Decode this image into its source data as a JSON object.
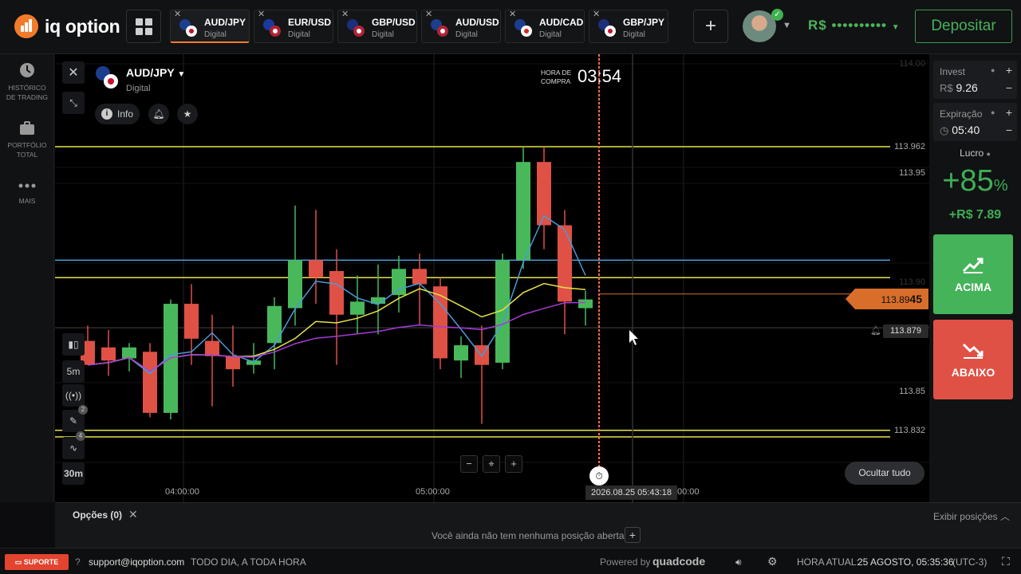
{
  "brand": {
    "name": "iq option",
    "accent": "#f27b2a"
  },
  "tabs": [
    {
      "pair": "AUD/JPY",
      "kind": "Digital",
      "active": true
    },
    {
      "pair": "EUR/USD",
      "kind": "Digital",
      "active": false
    },
    {
      "pair": "GBP/USD",
      "kind": "Digital",
      "active": false
    },
    {
      "pair": "AUD/USD",
      "kind": "Digital",
      "active": false
    },
    {
      "pair": "AUD/CAD",
      "kind": "Digital",
      "active": false
    },
    {
      "pair": "GBP/JPY",
      "kind": "Digital",
      "active": false
    }
  ],
  "header": {
    "balance": "R$ ••••••••••",
    "deposit_label": "Depositar"
  },
  "sidebar": {
    "items": [
      {
        "icon": "clock-icon",
        "label_1": "HISTÓRICO",
        "label_2": "DE TRADING"
      },
      {
        "icon": "briefcase-icon",
        "label_1": "PORTFÓLIO",
        "label_2": "TOTAL"
      },
      {
        "icon": "more-dots-icon",
        "label_1": "MAIS",
        "label_2": ""
      }
    ]
  },
  "chart": {
    "asset": "AUD/JPY",
    "asset_kind": "Digital",
    "info_label": "Info",
    "hora_label_1": "HORA DE",
    "hora_label_2": "COMPRA",
    "countdown": "03:54",
    "current_price_main": "113.89",
    "current_price_tail": "45",
    "alert_price": "113.879",
    "price_labels": [
      "114.00",
      "113.962",
      "113.95",
      "113.90",
      "113.85",
      "113.832"
    ],
    "time_labels": [
      "04:00:00",
      "05:00:00",
      "00:00"
    ],
    "cursor_time": "2026.08.25 05:43:18",
    "timeframe": "5m",
    "chart_interval": "30m",
    "indicator_badge": "2",
    "drawing_badge": "4",
    "hide_all_label": "Ocultar tudo",
    "candles": [
      {
        "o": 113.873,
        "h": 113.88,
        "l": 113.862,
        "c": 113.862
      },
      {
        "o": 113.87,
        "h": 113.878,
        "l": 113.857,
        "c": 113.864
      },
      {
        "o": 113.865,
        "h": 113.872,
        "l": 113.859,
        "c": 113.87
      },
      {
        "o": 113.868,
        "h": 113.872,
        "l": 113.838,
        "c": 113.84
      },
      {
        "o": 113.84,
        "h": 113.892,
        "l": 113.837,
        "c": 113.89
      },
      {
        "o": 113.89,
        "h": 113.899,
        "l": 113.862,
        "c": 113.874
      },
      {
        "o": 113.873,
        "h": 113.885,
        "l": 113.843,
        "c": 113.866
      },
      {
        "o": 113.866,
        "h": 113.88,
        "l": 113.852,
        "c": 113.86
      },
      {
        "o": 113.862,
        "h": 113.872,
        "l": 113.858,
        "c": 113.864
      },
      {
        "o": 113.872,
        "h": 113.893,
        "l": 113.86,
        "c": 113.889
      },
      {
        "o": 113.888,
        "h": 113.935,
        "l": 113.88,
        "c": 113.91
      },
      {
        "o": 113.91,
        "h": 113.933,
        "l": 113.89,
        "c": 113.902
      },
      {
        "o": 113.905,
        "h": 113.915,
        "l": 113.862,
        "c": 113.885
      },
      {
        "o": 113.885,
        "h": 113.903,
        "l": 113.876,
        "c": 113.891
      },
      {
        "o": 113.89,
        "h": 113.908,
        "l": 113.876,
        "c": 113.893
      },
      {
        "o": 113.894,
        "h": 113.912,
        "l": 113.886,
        "c": 113.906
      },
      {
        "o": 113.906,
        "h": 113.913,
        "l": 113.88,
        "c": 113.899
      },
      {
        "o": 113.898,
        "h": 113.902,
        "l": 113.86,
        "c": 113.865
      },
      {
        "o": 113.864,
        "h": 113.875,
        "l": 113.856,
        "c": 113.871
      },
      {
        "o": 113.871,
        "h": 113.88,
        "l": 113.835,
        "c": 113.862
      },
      {
        "o": 113.863,
        "h": 113.913,
        "l": 113.86,
        "c": 113.91
      },
      {
        "o": 113.91,
        "h": 113.962,
        "l": 113.906,
        "c": 113.955
      },
      {
        "o": 113.955,
        "h": 113.962,
        "l": 113.915,
        "c": 113.926
      },
      {
        "o": 113.926,
        "h": 113.933,
        "l": 113.876,
        "c": 113.891
      },
      {
        "o": 113.888,
        "h": 113.896,
        "l": 113.88,
        "c": 113.892
      }
    ],
    "levels": [
      {
        "price": 113.962,
        "color": "#e6e34a"
      },
      {
        "price": 113.91,
        "color": "#4aa3df"
      },
      {
        "price": 113.902,
        "color": "#e6e34a"
      },
      {
        "price": 113.832,
        "color": "#e6e34a"
      },
      {
        "price": 113.829,
        "color": "#e6e34a"
      }
    ]
  },
  "trade": {
    "invest_label": "Invest",
    "invest_currency": "R$",
    "invest_value": "9.26",
    "expiry_label": "Expiração",
    "expiry_value": "05:40",
    "profit_label": "Lucro",
    "profit_pct": "+85",
    "profit_pct_sign": "%",
    "profit_value": "+R$ 7.89",
    "up_label": "ACIMA",
    "down_label": "ABAIXO",
    "up_color": "#45b35a",
    "down_color": "#df5145"
  },
  "positions": {
    "title": "Opções (0)",
    "empty_text": "Você ainda não tem nenhuma posição aberta",
    "show_label": "Exibir posições"
  },
  "footer": {
    "support_label": "SUPORTE",
    "email": "support@iqoption.com",
    "hours": "TODO DIA, A TODA HORA",
    "powered": "Powered by",
    "powered_brand": "quadcode",
    "time_label": "HORA ATUAL:",
    "time_value": "25 AGOSTO, 05:35:36",
    "tz": "(UTC-3)"
  }
}
